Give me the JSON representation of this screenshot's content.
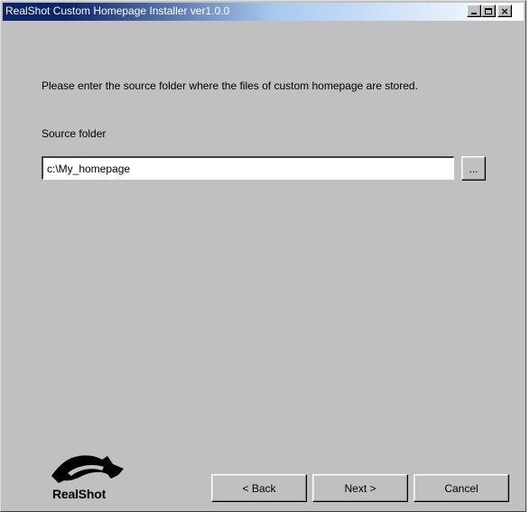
{
  "window": {
    "title": "RealShot Custom Homepage Installer ver1.0.0"
  },
  "content": {
    "prompt": "Please enter the source folder where the files of custom homepage are stored.",
    "source_label": "Source folder",
    "source_value": "c:\\My_homepage",
    "browse_label": "..."
  },
  "footer": {
    "logo_text": "RealShot",
    "back_label": "< Back",
    "next_label": "Next >",
    "cancel_label": "Cancel"
  }
}
